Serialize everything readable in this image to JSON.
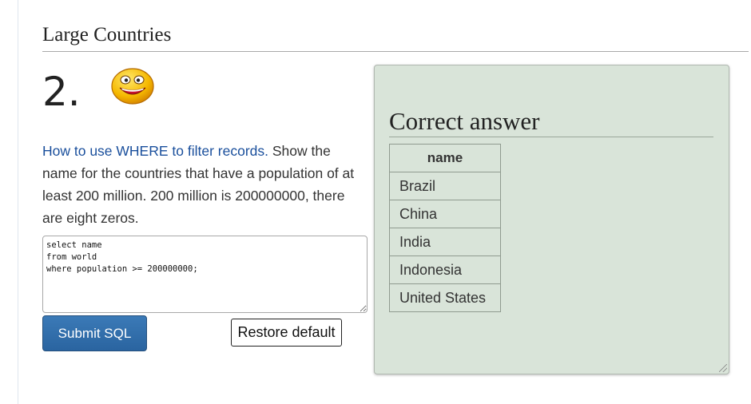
{
  "section": {
    "title": "Large Countries"
  },
  "question": {
    "number": "2.",
    "link_text": "How to use WHERE to filter records.",
    "text": " Show the name for the countries that have a population of at least 200 million. 200 million is 200000000, there are eight zeros."
  },
  "editor": {
    "value": "select name\nfrom world\nwhere population >= 200000000;"
  },
  "buttons": {
    "submit_label": "Submit SQL",
    "restore_label": "Restore default"
  },
  "answer": {
    "heading": "Correct answer",
    "columns": [
      "name"
    ],
    "rows": [
      "Brazil",
      "China",
      "India",
      "Indonesia",
      "United States"
    ]
  },
  "colors": {
    "link": "#1a4f9c",
    "submit_button": "#2f6ba8",
    "answer_panel_bg": "#d9e4d9"
  },
  "icons": {
    "feedback": "smiley-icon"
  }
}
